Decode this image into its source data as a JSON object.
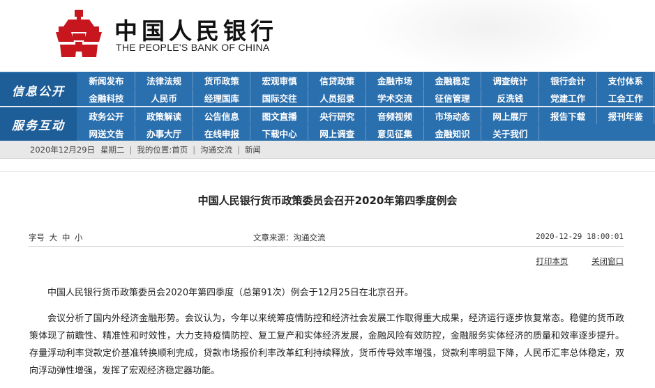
{
  "header": {
    "logo_cn": "中国人民银行",
    "logo_en": "THE PEOPLE'S BANK OF CHINA"
  },
  "nav": {
    "section1": "信息公开",
    "section2": "服务互动",
    "row1": [
      "新闻发布",
      "法律法规",
      "货币政策",
      "宏观审慎",
      "信贷政策",
      "金融市场",
      "金融稳定",
      "调查统计",
      "银行会计",
      "支付体系"
    ],
    "row2": [
      "金融科技",
      "人民币",
      "经理国库",
      "国际交往",
      "人员招录",
      "学术交流",
      "征信管理",
      "反洗钱",
      "党建工作",
      "工会工作"
    ],
    "row3": [
      "政务公开",
      "政策解读",
      "公告信息",
      "图文直播",
      "央行研究",
      "音频视频",
      "市场动态",
      "网上展厅",
      "报告下载",
      "报刊年鉴"
    ],
    "row4": [
      "网送文告",
      "办事大厅",
      "在线申报",
      "下载中心",
      "网上调查",
      "意见征集",
      "金融知识",
      "关于我们"
    ]
  },
  "breadcrumb": {
    "date": "2020年12月29日",
    "weekday": "星期二",
    "location_label": "我的位置:",
    "home": "首页",
    "level1": "沟通交流",
    "level2": "新闻"
  },
  "article": {
    "title": "中国人民银行货币政策委员会召开2020年第四季度例会",
    "font_label": "字号",
    "font_large": "大",
    "font_medium": "中",
    "font_small": "小",
    "source": "文章来源：沟通交流",
    "time": "2020-12-29 18:00:01",
    "print": "打印本页",
    "close": "关闭窗口",
    "paragraphs": [
      "中国人民银行货币政策委员会2020年第四季度（总第91次）例会于12月25日在北京召开。",
      "会议分析了国内外经济金融形势。会议认为，今年以来统筹疫情防控和经济社会发展工作取得重大成果，经济运行逐步恢复常态。稳健的货币政策体现了前瞻性、精准性和时效性，大力支持疫情防控、复工复产和实体经济发展，金融风险有效防控，金融服务实体经济的质量和效率逐步提升。存量浮动利率贷款定价基准转换顺利完成，贷款市场报价利率改革红利持续释放，货币传导效率增强，贷款利率明显下降，人民币汇率总体稳定，双向浮动弹性增强，发挥了宏观经济稳定器功能。"
    ]
  },
  "colors": {
    "nav_bg": "#2a6fae",
    "nav_section_bg": "#1d5d98",
    "emblem_red": "#c8161e"
  }
}
